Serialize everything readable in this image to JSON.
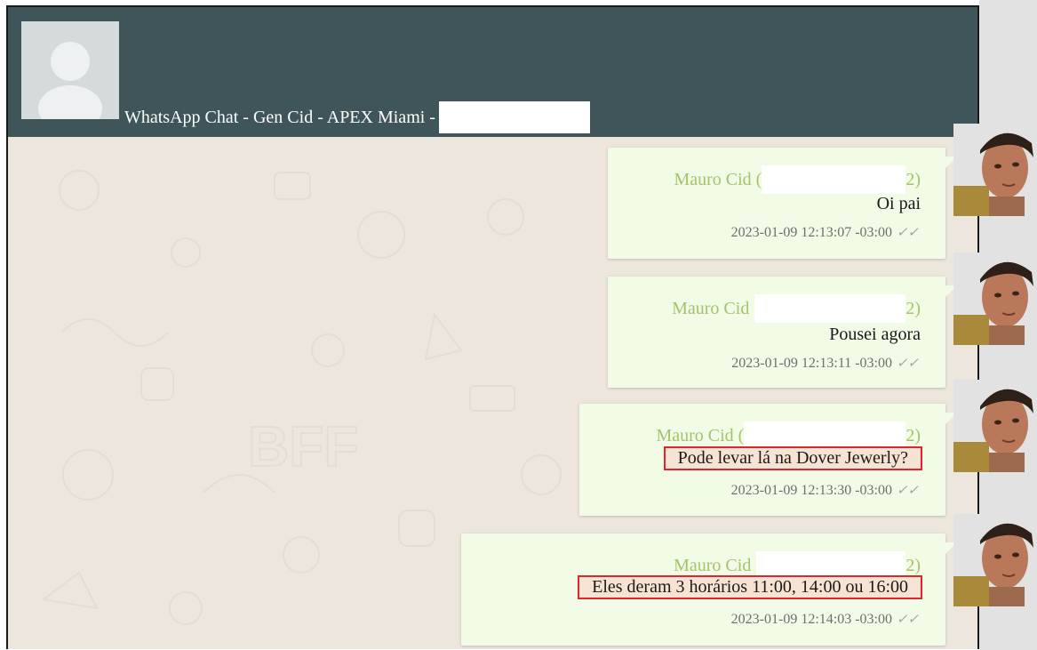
{
  "header": {
    "title": "WhatsApp Chat - Gen Cid - APEX Miami -"
  },
  "messages": [
    {
      "sender_prefix": "Mauro Cid (",
      "sender_suffix": "2)",
      "text": "Oi pai",
      "timestamp": "2023-01-09 12:13:07 -03:00",
      "highlighted": false
    },
    {
      "sender_prefix": "Mauro Cid",
      "sender_suffix": "2)",
      "text": "Pousei agora",
      "timestamp": "2023-01-09 12:13:11 -03:00",
      "highlighted": false
    },
    {
      "sender_prefix": "Mauro Cid (",
      "sender_suffix": "2)",
      "text": "Pode levar lá na Dover Jewerly?",
      "timestamp": "2023-01-09 12:13:30 -03:00",
      "highlighted": true
    },
    {
      "sender_prefix": "Mauro Cid",
      "sender_suffix": "2)",
      "text": "Eles deram 3 horários 11:00, 14:00 ou 16:00",
      "timestamp": "2023-01-09 12:14:03 -03:00",
      "highlighted": true
    }
  ],
  "read_receipt_icon": "double-check-icon",
  "colors": {
    "header_bg": "#3f555a",
    "bubble_bg": "#f2fbe6",
    "sender_name": "#a7c26a",
    "highlight_border": "#e0262a"
  }
}
